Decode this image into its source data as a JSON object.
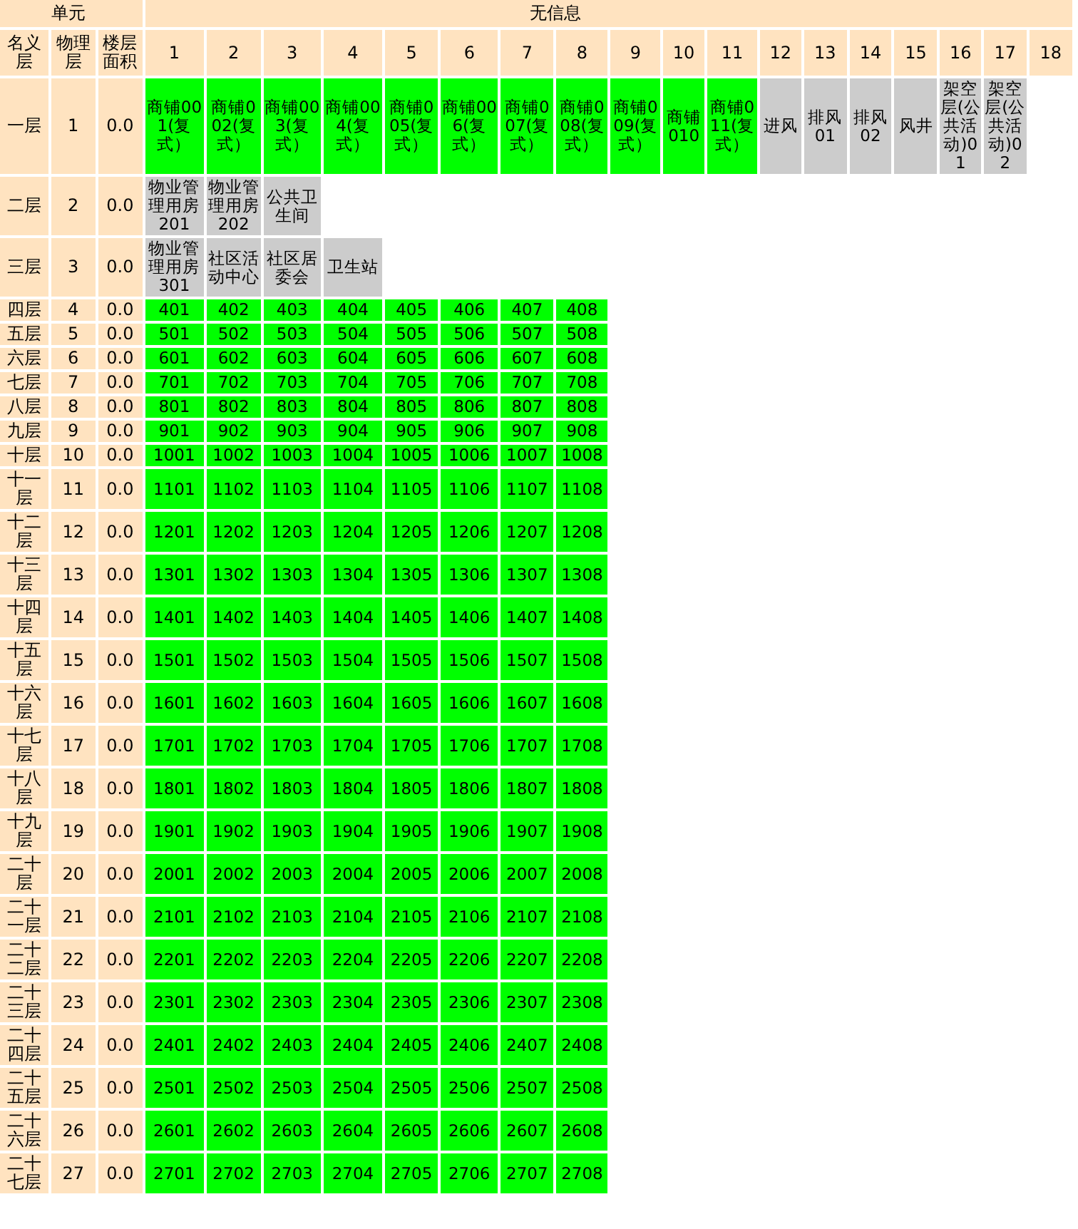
{
  "header": {
    "unit_label": "单元",
    "info_label": "无信息"
  },
  "columns": {
    "nominal_floor": "名义层",
    "physical_floor": "物理层",
    "floor_area": "楼层面积",
    "units": [
      "1",
      "2",
      "3",
      "4",
      "5",
      "6",
      "7",
      "8",
      "9",
      "10",
      "11",
      "12",
      "13",
      "14",
      "15",
      "16",
      "17",
      "18"
    ]
  },
  "floors": [
    {
      "name": "一层",
      "number": "1",
      "area": "0.0",
      "units": [
        {
          "label": "商铺001(复式）",
          "color": "#00ff00"
        },
        {
          "label": "商铺002(复式）",
          "color": "#00ff00"
        },
        {
          "label": "商铺003(复式）",
          "color": "#00ff00"
        },
        {
          "label": "商铺004(复式）",
          "color": "#00ff00"
        },
        {
          "label": "商铺005(复式）",
          "color": "#00ff00"
        },
        {
          "label": "商铺006(复式）",
          "color": "#00ff00"
        },
        {
          "label": "商铺007(复式）",
          "color": "#00ff00"
        },
        {
          "label": "商铺008(复式）",
          "color": "#00ff00"
        },
        {
          "label": "商铺009(复式）",
          "color": "#00ff00"
        },
        {
          "label": "商铺010",
          "color": "#00ff00"
        },
        {
          "label": "商铺011(复式）",
          "color": "#00ff00"
        },
        {
          "label": "进风",
          "color": "#cccccc"
        },
        {
          "label": "排风01",
          "color": "#cccccc"
        },
        {
          "label": "排风02",
          "color": "#cccccc"
        },
        {
          "label": "风井",
          "color": "#cccccc"
        },
        {
          "label": "架空层(公共活动)01",
          "color": "#cccccc"
        },
        {
          "label": "架空层(公共活动)02",
          "color": "#cccccc"
        }
      ]
    },
    {
      "name": "二层",
      "number": "2",
      "area": "0.0",
      "units": [
        {
          "label": "物业管理用房201",
          "color": "#cccccc"
        },
        {
          "label": "物业管理用房202",
          "color": "#cccccc"
        },
        {
          "label": "公共卫生间",
          "color": "#cccccc"
        }
      ]
    },
    {
      "name": "三层",
      "number": "3",
      "area": "0.0",
      "units": [
        {
          "label": "物业管理用房301",
          "color": "#cccccc"
        },
        {
          "label": "社区活动中心",
          "color": "#cccccc"
        },
        {
          "label": "社区居委会",
          "color": "#cccccc"
        },
        {
          "label": "卫生站",
          "color": "#cccccc"
        }
      ]
    },
    {
      "name": "四层",
      "number": "4",
      "area": "0.0",
      "units": [
        {
          "label": "401",
          "color": "#00ff00"
        },
        {
          "label": "402",
          "color": "#00ff00"
        },
        {
          "label": "403",
          "color": "#00ff00"
        },
        {
          "label": "404",
          "color": "#00ff00"
        },
        {
          "label": "405",
          "color": "#00ff00"
        },
        {
          "label": "406",
          "color": "#00ff00"
        },
        {
          "label": "407",
          "color": "#00ff00"
        },
        {
          "label": "408",
          "color": "#00ff00"
        }
      ]
    },
    {
      "name": "五层",
      "number": "5",
      "area": "0.0",
      "units": [
        {
          "label": "501",
          "color": "#00ff00"
        },
        {
          "label": "502",
          "color": "#00ff00"
        },
        {
          "label": "503",
          "color": "#00ff00"
        },
        {
          "label": "504",
          "color": "#00ff00"
        },
        {
          "label": "505",
          "color": "#00ff00"
        },
        {
          "label": "506",
          "color": "#00ff00"
        },
        {
          "label": "507",
          "color": "#00ff00"
        },
        {
          "label": "508",
          "color": "#00ff00"
        }
      ]
    },
    {
      "name": "六层",
      "number": "6",
      "area": "0.0",
      "units": [
        {
          "label": "601",
          "color": "#00ff00"
        },
        {
          "label": "602",
          "color": "#00ff00"
        },
        {
          "label": "603",
          "color": "#00ff00"
        },
        {
          "label": "604",
          "color": "#00ff00"
        },
        {
          "label": "605",
          "color": "#00ff00"
        },
        {
          "label": "606",
          "color": "#00ff00"
        },
        {
          "label": "607",
          "color": "#00ff00"
        },
        {
          "label": "608",
          "color": "#00ff00"
        }
      ]
    },
    {
      "name": "七层",
      "number": "7",
      "area": "0.0",
      "units": [
        {
          "label": "701",
          "color": "#00ff00"
        },
        {
          "label": "702",
          "color": "#00ff00"
        },
        {
          "label": "703",
          "color": "#00ff00"
        },
        {
          "label": "704",
          "color": "#00ff00"
        },
        {
          "label": "705",
          "color": "#00ff00"
        },
        {
          "label": "706",
          "color": "#00ff00"
        },
        {
          "label": "707",
          "color": "#00ff00"
        },
        {
          "label": "708",
          "color": "#00ff00"
        }
      ]
    },
    {
      "name": "八层",
      "number": "8",
      "area": "0.0",
      "units": [
        {
          "label": "801",
          "color": "#00ff00"
        },
        {
          "label": "802",
          "color": "#00ff00"
        },
        {
          "label": "803",
          "color": "#00ff00"
        },
        {
          "label": "804",
          "color": "#00ff00"
        },
        {
          "label": "805",
          "color": "#00ff00"
        },
        {
          "label": "806",
          "color": "#00ff00"
        },
        {
          "label": "807",
          "color": "#00ff00"
        },
        {
          "label": "808",
          "color": "#00ff00"
        }
      ]
    },
    {
      "name": "九层",
      "number": "9",
      "area": "0.0",
      "units": [
        {
          "label": "901",
          "color": "#00ff00"
        },
        {
          "label": "902",
          "color": "#00ff00"
        },
        {
          "label": "903",
          "color": "#00ff00"
        },
        {
          "label": "904",
          "color": "#00ff00"
        },
        {
          "label": "905",
          "color": "#00ff00"
        },
        {
          "label": "906",
          "color": "#00ff00"
        },
        {
          "label": "907",
          "color": "#00ff00"
        },
        {
          "label": "908",
          "color": "#00ff00"
        }
      ]
    },
    {
      "name": "十层",
      "number": "10",
      "area": "0.0",
      "units": [
        {
          "label": "1001",
          "color": "#00ff00"
        },
        {
          "label": "1002",
          "color": "#00ff00"
        },
        {
          "label": "1003",
          "color": "#00ff00"
        },
        {
          "label": "1004",
          "color": "#00ff00"
        },
        {
          "label": "1005",
          "color": "#00ff00"
        },
        {
          "label": "1006",
          "color": "#00ff00"
        },
        {
          "label": "1007",
          "color": "#00ff00"
        },
        {
          "label": "1008",
          "color": "#00ff00"
        }
      ]
    },
    {
      "name": "十一层",
      "number": "11",
      "area": "0.0",
      "units": [
        {
          "label": "1101",
          "color": "#00ff00"
        },
        {
          "label": "1102",
          "color": "#00ff00"
        },
        {
          "label": "1103",
          "color": "#00ff00"
        },
        {
          "label": "1104",
          "color": "#00ff00"
        },
        {
          "label": "1105",
          "color": "#00ff00"
        },
        {
          "label": "1106",
          "color": "#00ff00"
        },
        {
          "label": "1107",
          "color": "#00ff00"
        },
        {
          "label": "1108",
          "color": "#00ff00"
        }
      ]
    },
    {
      "name": "十二层",
      "number": "12",
      "area": "0.0",
      "units": [
        {
          "label": "1201",
          "color": "#00ff00"
        },
        {
          "label": "1202",
          "color": "#00ff00"
        },
        {
          "label": "1203",
          "color": "#00ff00"
        },
        {
          "label": "1204",
          "color": "#00ff00"
        },
        {
          "label": "1205",
          "color": "#00ff00"
        },
        {
          "label": "1206",
          "color": "#00ff00"
        },
        {
          "label": "1207",
          "color": "#00ff00"
        },
        {
          "label": "1208",
          "color": "#00ff00"
        }
      ]
    },
    {
      "name": "十三层",
      "number": "13",
      "area": "0.0",
      "units": [
        {
          "label": "1301",
          "color": "#00ff00"
        },
        {
          "label": "1302",
          "color": "#00ff00"
        },
        {
          "label": "1303",
          "color": "#00ff00"
        },
        {
          "label": "1304",
          "color": "#00ff00"
        },
        {
          "label": "1305",
          "color": "#00ff00"
        },
        {
          "label": "1306",
          "color": "#00ff00"
        },
        {
          "label": "1307",
          "color": "#00ff00"
        },
        {
          "label": "1308",
          "color": "#00ff00"
        }
      ]
    },
    {
      "name": "十四层",
      "number": "14",
      "area": "0.0",
      "units": [
        {
          "label": "1401",
          "color": "#00ff00"
        },
        {
          "label": "1402",
          "color": "#00ff00"
        },
        {
          "label": "1403",
          "color": "#00ff00"
        },
        {
          "label": "1404",
          "color": "#00ff00"
        },
        {
          "label": "1405",
          "color": "#00ff00"
        },
        {
          "label": "1406",
          "color": "#00ff00"
        },
        {
          "label": "1407",
          "color": "#00ff00"
        },
        {
          "label": "1408",
          "color": "#00ff00"
        }
      ]
    },
    {
      "name": "十五层",
      "number": "15",
      "area": "0.0",
      "units": [
        {
          "label": "1501",
          "color": "#00ff00"
        },
        {
          "label": "1502",
          "color": "#00ff00"
        },
        {
          "label": "1503",
          "color": "#00ff00"
        },
        {
          "label": "1504",
          "color": "#00ff00"
        },
        {
          "label": "1505",
          "color": "#00ff00"
        },
        {
          "label": "1506",
          "color": "#00ff00"
        },
        {
          "label": "1507",
          "color": "#00ff00"
        },
        {
          "label": "1508",
          "color": "#00ff00"
        }
      ]
    },
    {
      "name": "十六层",
      "number": "16",
      "area": "0.0",
      "units": [
        {
          "label": "1601",
          "color": "#00ff00"
        },
        {
          "label": "1602",
          "color": "#00ff00"
        },
        {
          "label": "1603",
          "color": "#00ff00"
        },
        {
          "label": "1604",
          "color": "#00ff00"
        },
        {
          "label": "1605",
          "color": "#00ff00"
        },
        {
          "label": "1606",
          "color": "#00ff00"
        },
        {
          "label": "1607",
          "color": "#00ff00"
        },
        {
          "label": "1608",
          "color": "#00ff00"
        }
      ]
    },
    {
      "name": "十七层",
      "number": "17",
      "area": "0.0",
      "units": [
        {
          "label": "1701",
          "color": "#00ff00"
        },
        {
          "label": "1702",
          "color": "#00ff00"
        },
        {
          "label": "1703",
          "color": "#00ff00"
        },
        {
          "label": "1704",
          "color": "#00ff00"
        },
        {
          "label": "1705",
          "color": "#00ff00"
        },
        {
          "label": "1706",
          "color": "#00ff00"
        },
        {
          "label": "1707",
          "color": "#00ff00"
        },
        {
          "label": "1708",
          "color": "#00ff00"
        }
      ]
    },
    {
      "name": "十八层",
      "number": "18",
      "area": "0.0",
      "units": [
        {
          "label": "1801",
          "color": "#00ff00"
        },
        {
          "label": "1802",
          "color": "#00ff00"
        },
        {
          "label": "1803",
          "color": "#00ff00"
        },
        {
          "label": "1804",
          "color": "#00ff00"
        },
        {
          "label": "1805",
          "color": "#00ff00"
        },
        {
          "label": "1806",
          "color": "#00ff00"
        },
        {
          "label": "1807",
          "color": "#00ff00"
        },
        {
          "label": "1808",
          "color": "#00ff00"
        }
      ]
    },
    {
      "name": "十九层",
      "number": "19",
      "area": "0.0",
      "units": [
        {
          "label": "1901",
          "color": "#00ff00"
        },
        {
          "label": "1902",
          "color": "#00ff00"
        },
        {
          "label": "1903",
          "color": "#00ff00"
        },
        {
          "label": "1904",
          "color": "#00ff00"
        },
        {
          "label": "1905",
          "color": "#00ff00"
        },
        {
          "label": "1906",
          "color": "#00ff00"
        },
        {
          "label": "1907",
          "color": "#00ff00"
        },
        {
          "label": "1908",
          "color": "#00ff00"
        }
      ]
    },
    {
      "name": "二十层",
      "number": "20",
      "area": "0.0",
      "units": [
        {
          "label": "2001",
          "color": "#00ff00"
        },
        {
          "label": "2002",
          "color": "#00ff00"
        },
        {
          "label": "2003",
          "color": "#00ff00"
        },
        {
          "label": "2004",
          "color": "#00ff00"
        },
        {
          "label": "2005",
          "color": "#00ff00"
        },
        {
          "label": "2006",
          "color": "#00ff00"
        },
        {
          "label": "2007",
          "color": "#00ff00"
        },
        {
          "label": "2008",
          "color": "#00ff00"
        }
      ]
    },
    {
      "name": "二十一层",
      "number": "21",
      "area": "0.0",
      "units": [
        {
          "label": "2101",
          "color": "#00ff00"
        },
        {
          "label": "2102",
          "color": "#00ff00"
        },
        {
          "label": "2103",
          "color": "#00ff00"
        },
        {
          "label": "2104",
          "color": "#00ff00"
        },
        {
          "label": "2105",
          "color": "#00ff00"
        },
        {
          "label": "2106",
          "color": "#00ff00"
        },
        {
          "label": "2107",
          "color": "#00ff00"
        },
        {
          "label": "2108",
          "color": "#00ff00"
        }
      ]
    },
    {
      "name": "二十二层",
      "number": "22",
      "area": "0.0",
      "units": [
        {
          "label": "2201",
          "color": "#00ff00"
        },
        {
          "label": "2202",
          "color": "#00ff00"
        },
        {
          "label": "2203",
          "color": "#00ff00"
        },
        {
          "label": "2204",
          "color": "#00ff00"
        },
        {
          "label": "2205",
          "color": "#00ff00"
        },
        {
          "label": "2206",
          "color": "#00ff00"
        },
        {
          "label": "2207",
          "color": "#00ff00"
        },
        {
          "label": "2208",
          "color": "#00ff00"
        }
      ]
    },
    {
      "name": "二十三层",
      "number": "23",
      "area": "0.0",
      "units": [
        {
          "label": "2301",
          "color": "#00ff00"
        },
        {
          "label": "2302",
          "color": "#00ff00"
        },
        {
          "label": "2303",
          "color": "#00ff00"
        },
        {
          "label": "2304",
          "color": "#00ff00"
        },
        {
          "label": "2305",
          "color": "#00ff00"
        },
        {
          "label": "2306",
          "color": "#00ff00"
        },
        {
          "label": "2307",
          "color": "#00ff00"
        },
        {
          "label": "2308",
          "color": "#00ff00"
        }
      ]
    },
    {
      "name": "二十四层",
      "number": "24",
      "area": "0.0",
      "units": [
        {
          "label": "2401",
          "color": "#00ff00"
        },
        {
          "label": "2402",
          "color": "#00ff00"
        },
        {
          "label": "2403",
          "color": "#00ff00"
        },
        {
          "label": "2404",
          "color": "#00ff00"
        },
        {
          "label": "2405",
          "color": "#00ff00"
        },
        {
          "label": "2406",
          "color": "#00ff00"
        },
        {
          "label": "2407",
          "color": "#00ff00"
        },
        {
          "label": "2408",
          "color": "#00ff00"
        }
      ]
    },
    {
      "name": "二十五层",
      "number": "25",
      "area": "0.0",
      "units": [
        {
          "label": "2501",
          "color": "#00ff00"
        },
        {
          "label": "2502",
          "color": "#00ff00"
        },
        {
          "label": "2503",
          "color": "#00ff00"
        },
        {
          "label": "2504",
          "color": "#00ff00"
        },
        {
          "label": "2505",
          "color": "#00ff00"
        },
        {
          "label": "2506",
          "color": "#00ff00"
        },
        {
          "label": "2507",
          "color": "#00ff00"
        },
        {
          "label": "2508",
          "color": "#00ff00"
        }
      ]
    },
    {
      "name": "二十六层",
      "number": "26",
      "area": "0.0",
      "units": [
        {
          "label": "2601",
          "color": "#00ff00"
        },
        {
          "label": "2602",
          "color": "#00ff00"
        },
        {
          "label": "2603",
          "color": "#00ff00"
        },
        {
          "label": "2604",
          "color": "#00ff00"
        },
        {
          "label": "2605",
          "color": "#00ff00"
        },
        {
          "label": "2606",
          "color": "#00ff00"
        },
        {
          "label": "2607",
          "color": "#00ff00"
        },
        {
          "label": "2608",
          "color": "#00ff00"
        }
      ]
    },
    {
      "name": "二十七层",
      "number": "27",
      "area": "0.0",
      "units": [
        {
          "label": "2701",
          "color": "#00ff00"
        },
        {
          "label": "2702",
          "color": "#00ff00"
        },
        {
          "label": "2703",
          "color": "#00ff00"
        },
        {
          "label": "2704",
          "color": "#00ff00"
        },
        {
          "label": "2705",
          "color": "#00ff00"
        },
        {
          "label": "2706",
          "color": "#00ff00"
        },
        {
          "label": "2707",
          "color": "#00ff00"
        },
        {
          "label": "2708",
          "color": "#00ff00"
        }
      ]
    }
  ]
}
